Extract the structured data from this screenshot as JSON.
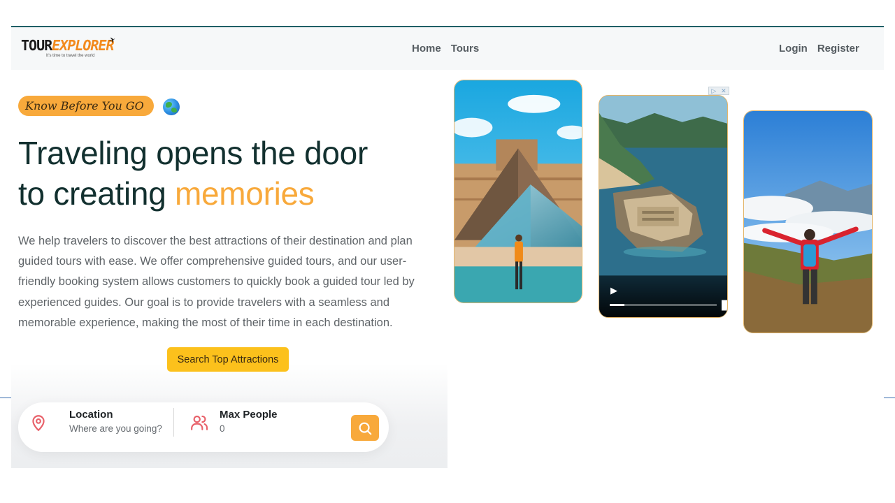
{
  "brand": {
    "logo_tour": "TOUR",
    "logo_explorer": "EXPLORER",
    "logo_tagline": "It's time to travel the world"
  },
  "nav": {
    "center_links": [
      "Home",
      "Tours"
    ],
    "right_links": [
      "Login",
      "Register"
    ]
  },
  "hero": {
    "badge": "Know Before You GO",
    "headline_line1": "Traveling opens the door",
    "headline_line2_prefix": "to creating ",
    "headline_accent": "memories",
    "description": "We help travelers to discover the best attractions of their destination and plan guided tours with ease. We offer comprehensive guided tours, and our user-friendly booking system allows customers to quickly book a guided tour led by experienced guides. Our goal is to provide travelers with a seamless and memorable experience, making the most of their time in each destination.",
    "cta_label": "Search Top Attractions"
  },
  "search": {
    "location_label": "Location",
    "location_placeholder": "Where are you going?",
    "people_label": "Max People",
    "people_value": "0"
  },
  "media": {
    "video_progress": 0.14
  },
  "colors": {
    "accent": "#f8a93b",
    "cta": "#fcc11c",
    "heading": "#12302f",
    "icon_red": "#e8616a"
  }
}
